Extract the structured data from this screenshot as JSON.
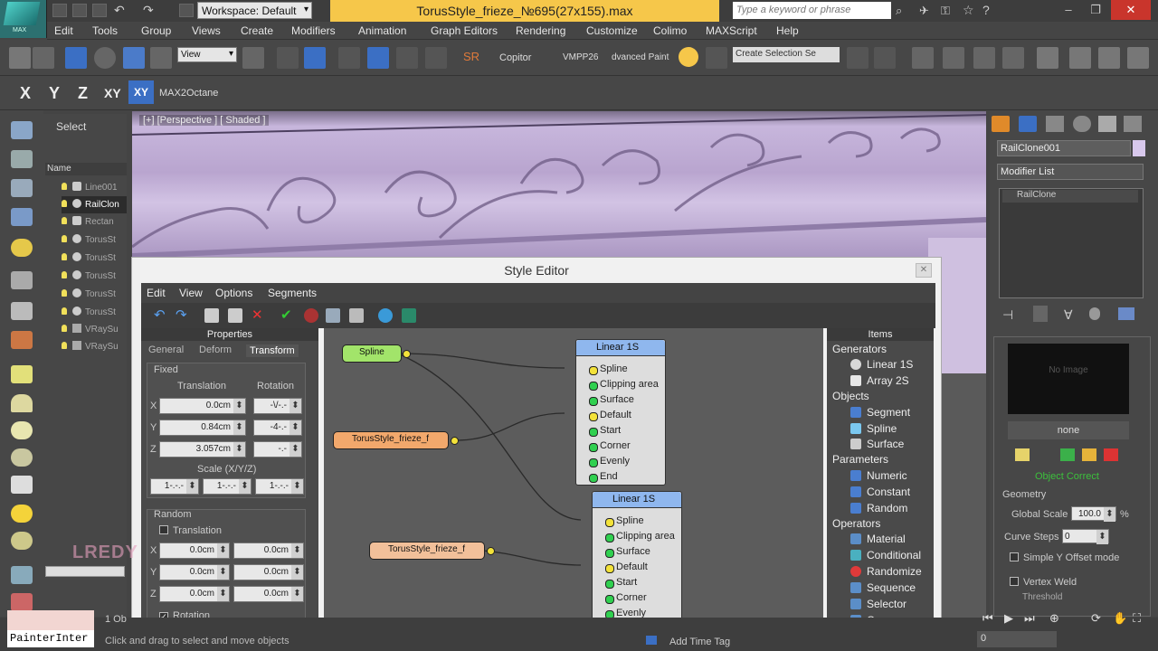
{
  "titlebar": {
    "workspace": "Workspace: Default",
    "doc_title": "TorusStyle_frieze_№695(27x155).max",
    "search_placeholder": "Type a keyword or phrase"
  },
  "menu": [
    "Edit",
    "Tools",
    "Group",
    "Views",
    "Create",
    "Modifiers",
    "Animation",
    "Graph Editors",
    "Rendering",
    "Customize",
    "Colimo",
    "MAXScript",
    "Help"
  ],
  "toolbar": {
    "view_select": "View",
    "sr_label": "SR",
    "copitor": "Copitor",
    "vmpp": "VMPP26",
    "paint": "dvanced Paint",
    "selection_set": "Create Selection Se"
  },
  "toolbar2": {
    "x": "X",
    "y": "Y",
    "z": "Z",
    "xy": "XY",
    "xy_active": "XY",
    "max2octane": "MAX2Octane"
  },
  "explorer": {
    "select": "Select",
    "name_header": "Name",
    "rows": [
      "Line001",
      "RailClon",
      "Rectan",
      "TorusSt",
      "TorusSt",
      "TorusSt",
      "TorusSt",
      "TorusSt",
      "VRaySu",
      "VRaySu"
    ]
  },
  "viewport": {
    "label": "[+] [Perspective ] [ Shaded ]"
  },
  "style_editor": {
    "title": "Style Editor",
    "menu": [
      "Edit",
      "View",
      "Options",
      "Segments"
    ],
    "properties": {
      "header": "Properties",
      "tabs": [
        "General",
        "Deform",
        "Transform"
      ],
      "fixed": "Fixed",
      "translation": "Translation",
      "rotation": "Rotation",
      "x_label": "X",
      "y_label": "Y",
      "z_label": "Z",
      "tx": "0.0cm",
      "ty": "0.84cm",
      "tz": "3.057cm",
      "rx": "-\\/-.-",
      "ry": "-4-.-",
      "rz": "-.-",
      "scale": "Scale (X/Y/Z)",
      "sx": "1-.-.-",
      "sy": "1-.-.-",
      "sz": "1-.-.-",
      "random": "Random",
      "rand_translation": "Translation",
      "r1a": "0.0cm",
      "r1b": "0.0cm",
      "r2a": "0.0cm",
      "r2b": "0.0cm",
      "r3a": "0.0cm",
      "r3b": "0.0cm",
      "rand_rotation": "Rotation"
    },
    "nodes": {
      "spline": "Spline",
      "torus1": "TorusStyle_frieze_f",
      "torus2": "TorusStyle_frieze_f",
      "linear1": "Linear 1S",
      "linear2": "Linear 1S",
      "ports": [
        "Spline",
        "Clipping area",
        "Surface",
        "Default",
        "Start",
        "Corner",
        "Evenly",
        "End"
      ]
    },
    "items": {
      "header": "Items",
      "generators": "Generators",
      "linear": "Linear 1S",
      "array": "Array 2S",
      "objects": "Objects",
      "segment": "Segment",
      "spline": "Spline",
      "surface": "Surface",
      "parameters": "Parameters",
      "numeric": "Numeric",
      "constant": "Constant",
      "random": "Random",
      "operators": "Operators",
      "material": "Material",
      "conditional": "Conditional",
      "randomize": "Randomize",
      "sequence": "Sequence",
      "selector": "Selector",
      "compose": "Compose"
    }
  },
  "command_panel": {
    "object_name": "RailClone001",
    "modifier_list": "Modifier List",
    "stack_item": "RailClone",
    "no_image": "No Image",
    "none": "none",
    "object_correct": "Object Correct",
    "geometry": "Geometry",
    "global_scale": "Global Scale",
    "global_scale_val": "100.0",
    "pct": "%",
    "curve_steps": "Curve Steps",
    "curve_steps_val": "0",
    "simple_y": "Simple Y Offset mode",
    "vertex_weld": "Vertex Weld",
    "threshold": "Threshold"
  },
  "bottom": {
    "painter": "PainterInter",
    "obj_count": "1 Ob",
    "status": "Click and drag to select and move objects",
    "add_time_tag": "Add Time Tag",
    "frame": "0"
  },
  "watermark": "LREDY",
  "colors": {
    "accent": "#3b6fc4",
    "title": "#f6c74a",
    "frieze": "#c2b0d8",
    "object_correct": "#38c238"
  }
}
